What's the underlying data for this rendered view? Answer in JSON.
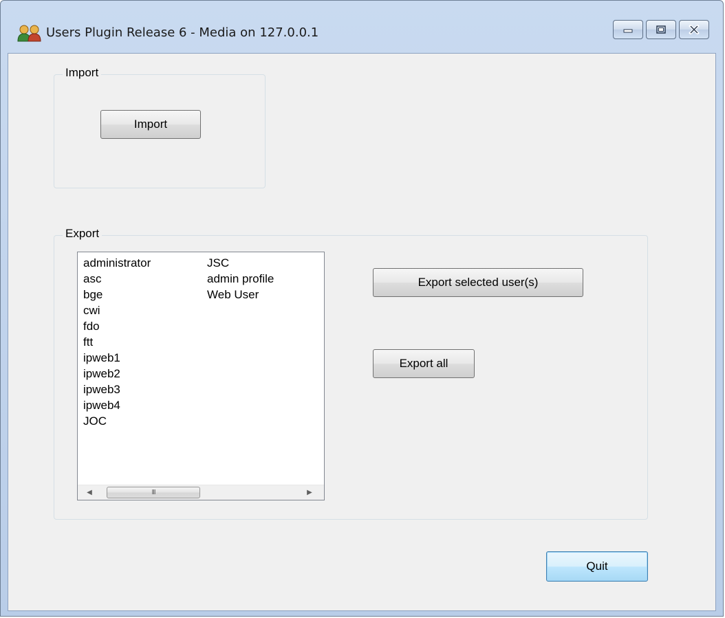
{
  "window": {
    "title": "Users Plugin Release 6 - Media on 127.0.0.1",
    "app_icon": "users-icon",
    "controls": [
      "minimize-icon",
      "maximize-icon",
      "close-icon"
    ]
  },
  "import_group": {
    "label": "Import",
    "button_label": "Import"
  },
  "export_group": {
    "label": "Export",
    "users_column_1": [
      "administrator",
      "asc",
      "bge",
      "cwi",
      "fdo",
      "ftt",
      "ipweb1",
      "ipweb2",
      "ipweb3",
      "ipweb4",
      "JOC"
    ],
    "users_column_2": [
      "JSC",
      "admin profile",
      "Web User"
    ],
    "export_selected_label": "Export selected user(s)",
    "export_all_label": "Export all",
    "scrollbar_thumb_glyph": "III"
  },
  "quit_label": "Quit",
  "colors": {
    "title_bar": "#c4d6ee",
    "client_bg": "#f0f0f0",
    "default_button_border": "#3c7fb1"
  }
}
